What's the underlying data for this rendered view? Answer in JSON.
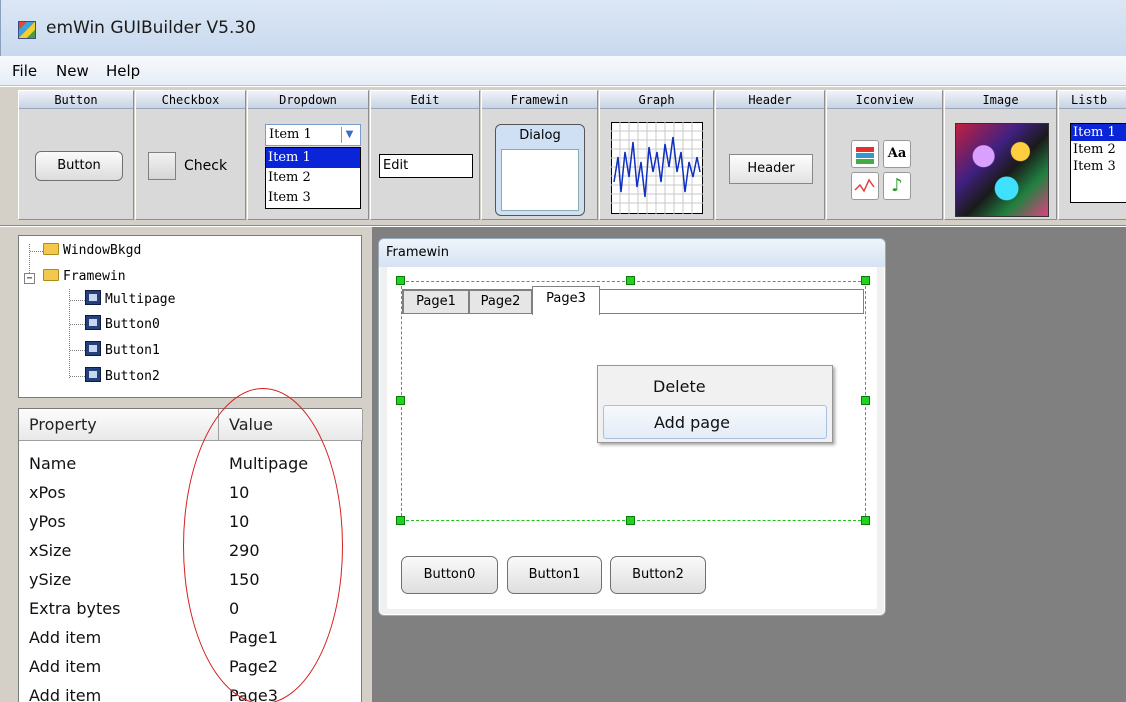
{
  "window": {
    "title": "emWin GUIBuilder V5.30"
  },
  "menu": [
    "File",
    "New",
    "Help"
  ],
  "palette": {
    "headers": [
      "Button",
      "Checkbox",
      "Dropdown",
      "Edit",
      "Framewin",
      "Graph",
      "Header",
      "Iconview",
      "Image",
      "Listb"
    ],
    "button_label": "Button",
    "checkbox_label": "Check",
    "dropdown_selected": "Item 1",
    "dropdown_items": [
      "Item 1",
      "Item 2",
      "Item 3"
    ],
    "edit_value": "Edit",
    "framewin_label": "Dialog",
    "header_label": "Header",
    "iconview_text_icon": "Aa",
    "listbox_items": [
      "Item 1",
      "Item 2",
      "Item 3"
    ]
  },
  "tree": {
    "items": [
      "WindowBkgd",
      "Framewin",
      "Multipage",
      "Button0",
      "Button1",
      "Button2"
    ]
  },
  "properties": {
    "col_property": "Property",
    "col_value": "Value",
    "rows": [
      {
        "name": "Name",
        "value": "Multipage"
      },
      {
        "name": "xPos",
        "value": "10"
      },
      {
        "name": "yPos",
        "value": "10"
      },
      {
        "name": "xSize",
        "value": "290"
      },
      {
        "name": "ySize",
        "value": "150"
      },
      {
        "name": "Extra bytes",
        "value": "0"
      },
      {
        "name": "Add item",
        "value": "Page1"
      },
      {
        "name": "Add item",
        "value": "Page2"
      },
      {
        "name": "Add item",
        "value": "Page3"
      }
    ]
  },
  "design": {
    "framewin_caption": "Framewin",
    "tabs": [
      "Page1",
      "Page2",
      "Page3"
    ],
    "buttons": [
      "Button0",
      "Button1",
      "Button2"
    ],
    "context_menu": [
      "Delete",
      "Add page"
    ]
  },
  "colors": {
    "selection": "#21d321",
    "annotation": "#d42020",
    "canvas": "#808080",
    "highlight": "#0a24d8"
  }
}
